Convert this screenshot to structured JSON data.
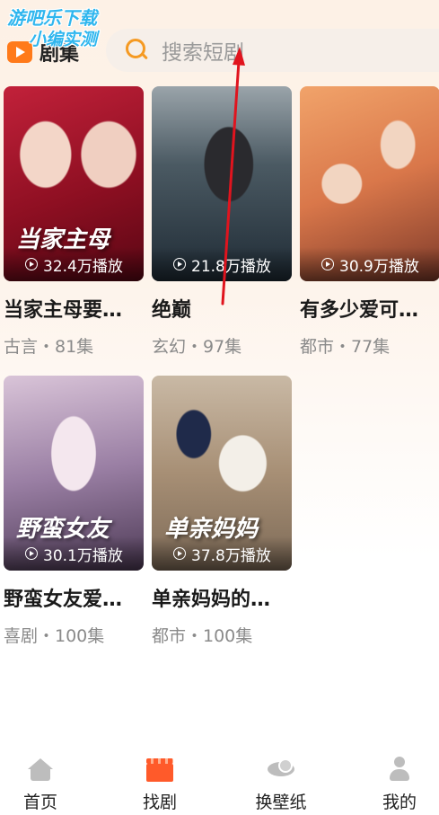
{
  "watermark": {
    "line1": "游吧乐下载",
    "line2": "小编实测"
  },
  "header": {
    "brand_label": "剧集",
    "search_placeholder": "搜索短剧"
  },
  "cards": [
    {
      "poster_title": "当家主母",
      "plays": "32.4万播放",
      "title": "当家主母要…",
      "meta": "古言・81集"
    },
    {
      "poster_title": "",
      "plays": "21.8万播放",
      "title": "绝巅",
      "meta": "玄幻・97集"
    },
    {
      "poster_title": "",
      "plays": "30.9万播放",
      "title": "有多少爱可…",
      "meta": "都市・77集"
    },
    {
      "poster_title": "野蛮女友",
      "plays": "30.1万播放",
      "title": "野蛮女友爱…",
      "meta": "喜剧・100集"
    },
    {
      "poster_title": "单亲妈妈",
      "plays": "37.8万播放",
      "title": "单亲妈妈的…",
      "meta": "都市・100集"
    }
  ],
  "tabbar": {
    "items": [
      {
        "label": "首页",
        "icon": "home-icon"
      },
      {
        "label": "找剧",
        "icon": "clapperboard-icon",
        "active": true
      },
      {
        "label": "换壁纸",
        "icon": "wallpaper-icon"
      },
      {
        "label": "我的",
        "icon": "user-icon"
      }
    ]
  },
  "colors": {
    "accent": "#f59a23",
    "active_tab_icon": "#ff5a2a",
    "annotation_arrow": "#e0141e"
  }
}
